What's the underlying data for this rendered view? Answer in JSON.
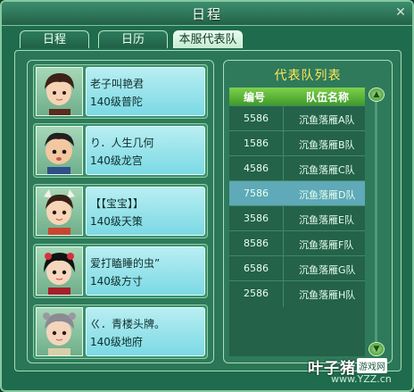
{
  "window": {
    "title": "日程",
    "close_glyph": "✕"
  },
  "tabs": [
    {
      "label": "日程",
      "active": false
    },
    {
      "label": "日历",
      "active": false
    },
    {
      "label": "本服代表队",
      "active": true
    }
  ],
  "members": [
    {
      "name": "老子叫艳君",
      "level": "140级普陀"
    },
    {
      "name": "り．人生几何",
      "level": "140级龙宫"
    },
    {
      "name": "【【宝宝】】",
      "level": "140级天策"
    },
    {
      "name": "爱打瞌睡的虫”",
      "level": "140级方寸"
    },
    {
      "name": "ㄍ．青楼头牌。",
      "level": "140级地府"
    }
  ],
  "team_list": {
    "title": "代表队列表",
    "headers": {
      "number": "编号",
      "team_name": "队伍名称"
    },
    "selected_index": 3,
    "rows": [
      {
        "number": "5586",
        "team_name": "沉鱼落雁A队"
      },
      {
        "number": "1586",
        "team_name": "沉鱼落雁B队"
      },
      {
        "number": "4586",
        "team_name": "沉鱼落雁C队"
      },
      {
        "number": "7586",
        "team_name": "沉鱼落雁D队"
      },
      {
        "number": "3586",
        "team_name": "沉鱼落雁E队"
      },
      {
        "number": "8586",
        "team_name": "沉鱼落雁F队"
      },
      {
        "number": "6586",
        "team_name": "沉鱼落雁G队"
      },
      {
        "number": "2586",
        "team_name": "沉鱼落雁H队"
      }
    ]
  },
  "watermark": {
    "brand": "叶子猪",
    "badge": "游戏网",
    "url": "www.YZZ.cn"
  },
  "colors": {
    "accent_yellow": "#ffe95a",
    "header_green": "#5fbf3a",
    "selected_row": "#5fa9b8"
  }
}
